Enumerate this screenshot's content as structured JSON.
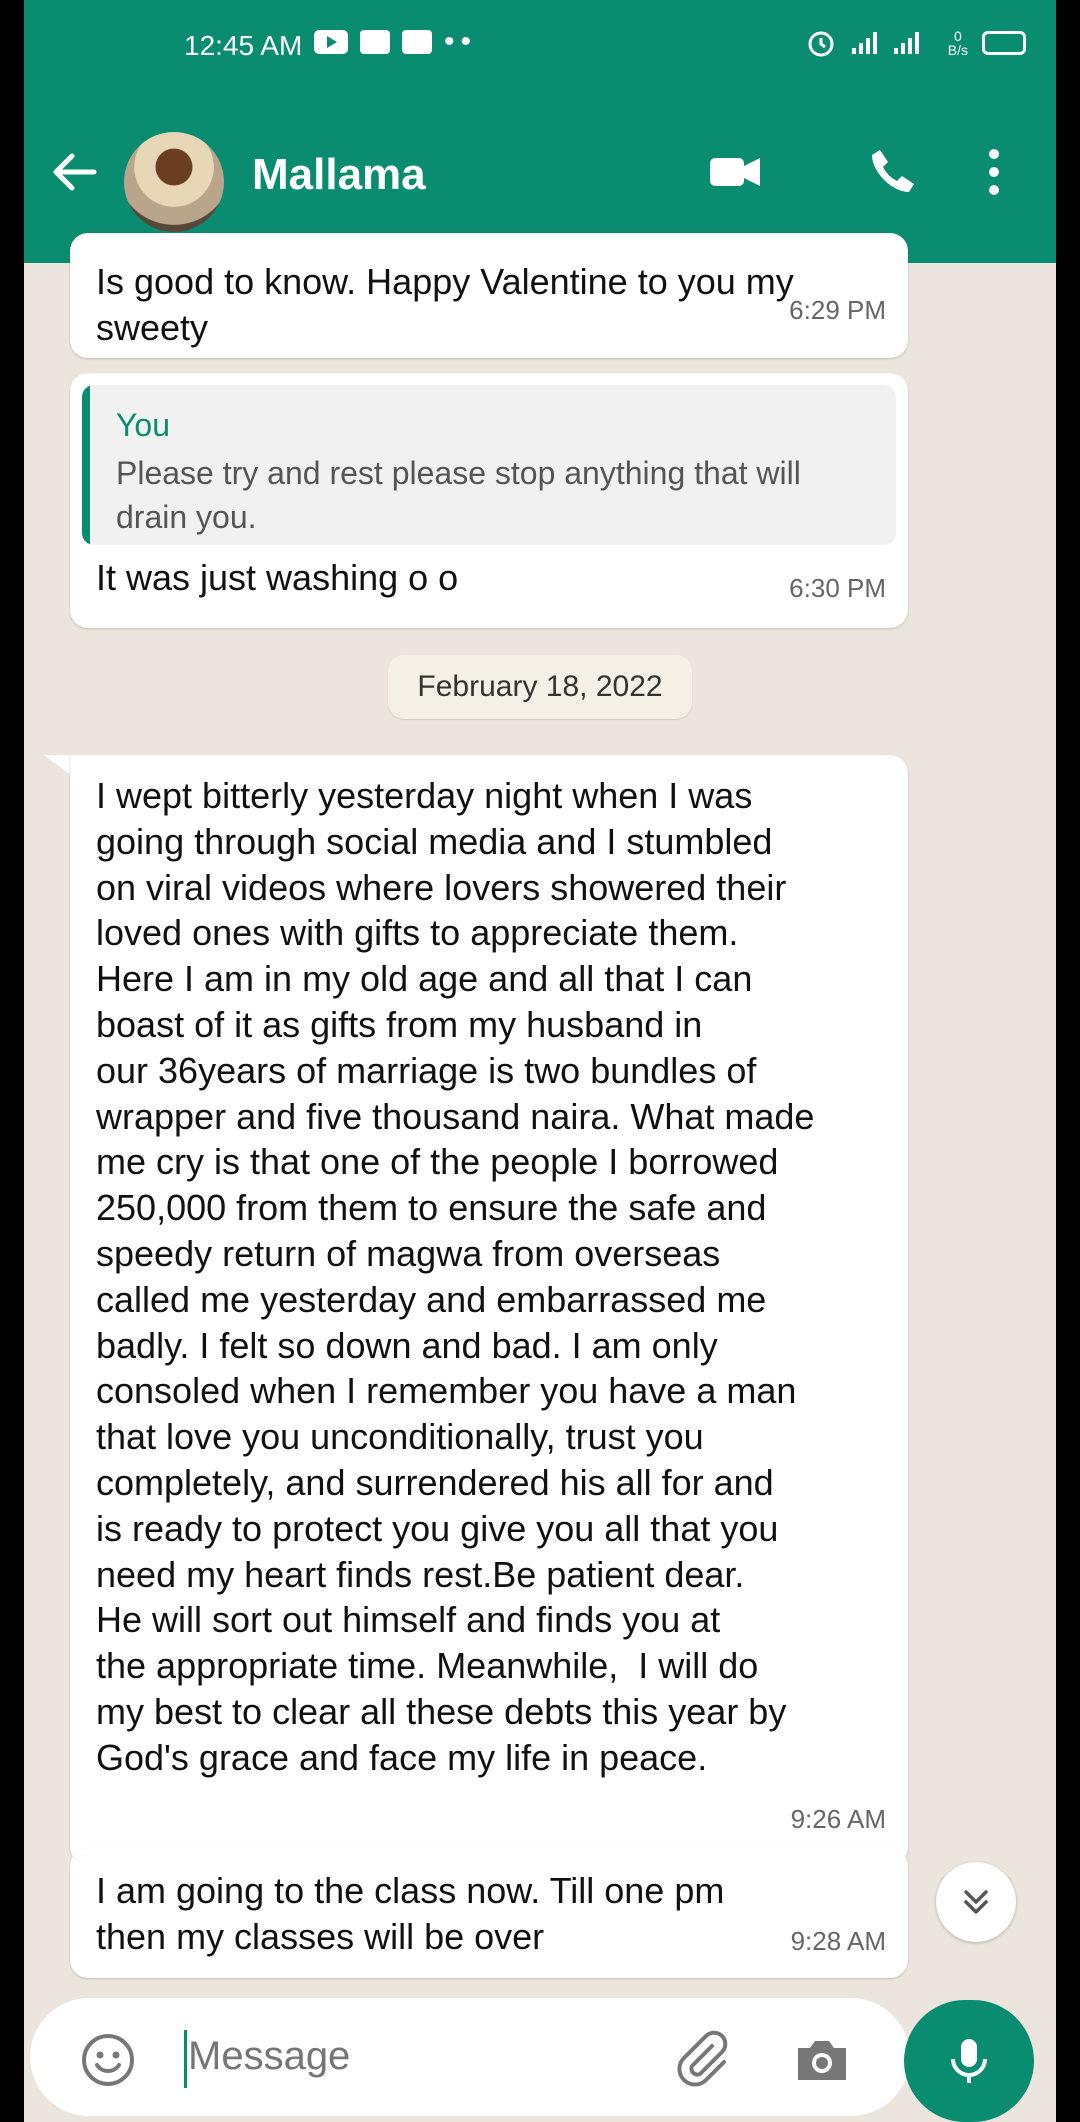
{
  "status_bar": {
    "time": "12:45 AM",
    "net_speed": "0\nB/s"
  },
  "header": {
    "contact_name": "Mallama"
  },
  "messages": [
    {
      "text": "Is good to know. Happy Valentine to you my\nsweety",
      "time": "6:29 PM"
    },
    {
      "quote_author": "You",
      "quote_text": "Please try and rest please stop anything that will\ndrain you.",
      "text": "It was just washing o o",
      "time": "6:30 PM"
    },
    {
      "text": "I wept bitterly yesterday night when I was\ngoing through social media and I stumbled\non viral videos where lovers showered their\nloved ones with gifts to appreciate them.\nHere I am in my old age and all that I can\nboast of it as gifts from my husband in\nour 36years of marriage is two bundles of\nwrapper and five thousand naira. What made\nme cry is that one of the people I borrowed\n250,000 from them to ensure the safe and\nspeedy return of magwa from overseas\ncalled me yesterday and embarrassed me\nbadly. I felt so down and bad. I am only\nconsoled when I remember you have a man\nthat love you unconditionally, trust you\ncompletely, and surrendered his all for and\nis ready to protect you give you all that you\nneed my heart finds rest.Be patient dear.\nHe will sort out himself and finds you at\nthe appropriate time. Meanwhile,  I will do\nmy best to clear all these debts this year by\nGod's grace and face my life in peace.",
      "time": "9:26 AM"
    },
    {
      "text": "I am going to the class now. Till one pm\nthen my classes will be over",
      "time": "9:28 AM"
    }
  ],
  "date_separator": "February 18, 2022",
  "composer": {
    "placeholder": "Message"
  },
  "colors": {
    "brand": "#0a8c70",
    "chat_bg": "#ece5dd",
    "bubble": "#ffffff"
  },
  "icons": {
    "back": "arrow-left-icon",
    "video": "video-camera-icon",
    "call": "phone-icon",
    "menu": "more-vert-icon",
    "emoji": "emoji-icon",
    "attach": "paperclip-icon",
    "camera": "camera-icon",
    "mic": "mic-icon",
    "scroll": "chevron-double-down-icon"
  }
}
